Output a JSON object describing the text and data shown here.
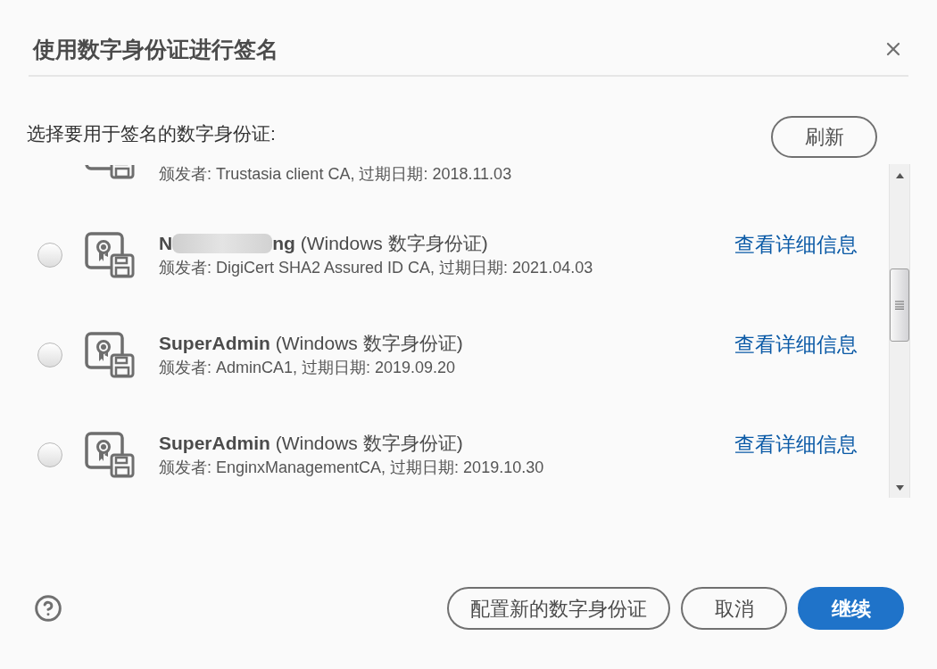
{
  "dialog": {
    "title": "使用数字身份证进行签名"
  },
  "prompt": "选择要用于签名的数字身份证:",
  "refresh_button": "刷新",
  "certificates": [
    {
      "kind": "partial",
      "issuer": "颁发者: Trustasia client CA, 过期日期: 2018.11.03"
    },
    {
      "kind": "full",
      "selected": false,
      "redacted": true,
      "title_prefix": "N",
      "title": "**ng** (Windows 数字身份证)",
      "issuer": "颁发者: DigiCert SHA2 Assured ID CA, 过期日期: 2021.04.03",
      "details_link": "查看详细信息"
    },
    {
      "kind": "full",
      "selected": false,
      "redacted": false,
      "title": "**SuperAdmin** (Windows 数字身份证)",
      "issuer": "颁发者: AdminCA1, 过期日期: 2019.09.20",
      "details_link": "查看详细信息"
    },
    {
      "kind": "full",
      "selected": false,
      "redacted": false,
      "title": "**SuperAdmin** (Windows 数字身份证)",
      "issuer": "颁发者: EnginxManagementCA, 过期日期: 2019.10.30",
      "details_link": "查看详细信息"
    }
  ],
  "footer": {
    "buttons": [
      {
        "label": "配置新的数字身份证",
        "kind": "secondary"
      },
      {
        "label": "取消",
        "kind": "secondary"
      },
      {
        "label": "继续",
        "kind": "primary"
      }
    ]
  }
}
